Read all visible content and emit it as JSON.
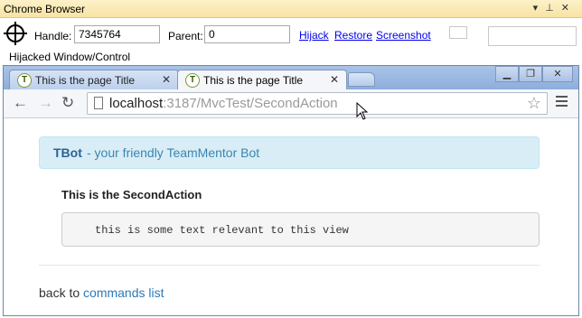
{
  "panel": {
    "title": "Chrome Browser"
  },
  "hijack": {
    "handle_label": "Handle:",
    "handle_value": "7345764",
    "parent_label": "Parent:",
    "parent_value": "0",
    "links": [
      "Hijack",
      "Restore",
      "Screenshot"
    ],
    "caption": "Hijacked Window/Control"
  },
  "browser": {
    "tabs": [
      {
        "title": "This is the page Title",
        "active": false
      },
      {
        "title": "This is the page Title",
        "active": true
      }
    ],
    "url_host": "localhost",
    "url_rest": ":3187/MvcTest/SecondAction"
  },
  "page": {
    "alert_brand": "TBot",
    "alert_text": " - your friendly TeamMentor Bot",
    "heading": "This is the SecondAction",
    "pre_text": "this is some text relevant to this view",
    "footer_text": "back to",
    "footer_link": "commands list"
  },
  "colors": {
    "link": "#2a7ab8",
    "alert_bg": "#d9edf7",
    "alert_text": "#3a87ad"
  }
}
